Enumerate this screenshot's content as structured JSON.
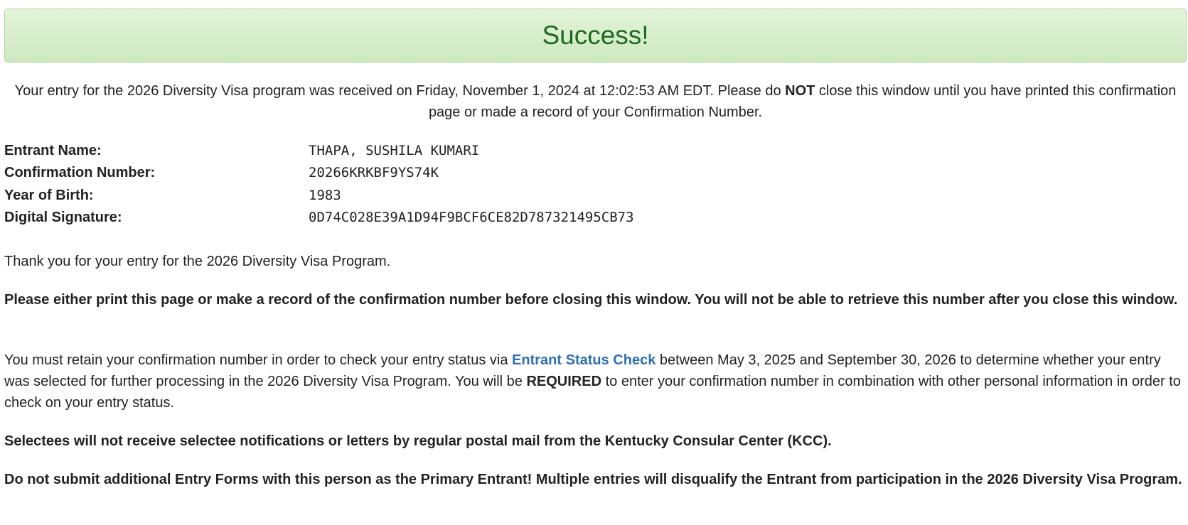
{
  "banner": {
    "title": "Success!"
  },
  "intro": {
    "part1": "Your entry for the 2026 Diversity Visa program was received on Friday, November 1, 2024 at 12:02:53 AM EDT. Please do ",
    "emphasis": "NOT",
    "part2": " close this window until you have printed this confirmation page or made a record of your Confirmation Number."
  },
  "entrant": {
    "name_label": "Entrant Name:",
    "name_value": "THAPA, SUSHILA KUMARI",
    "confirmation_label": "Confirmation Number:",
    "confirmation_value": "20266KRKBF9YS74K",
    "birth_label": "Year of Birth:",
    "birth_value": "1983",
    "signature_label": "Digital Signature:",
    "signature_value": "0D74C028E39A1D94F9BCF6CE82D787321495CB73"
  },
  "messages": {
    "thank_you": "Thank you for your entry for the 2026 Diversity Visa Program.",
    "print_warning": "Please either print this page or make a record of the confirmation number before closing this window. You will not be able to retrieve this number after you close this window.",
    "retain_part1": "You must retain your confirmation number in order to check your entry status via ",
    "retain_link": "Entrant Status Check",
    "retain_part2": " between May 3, 2025 and September 30, 2026 to determine whether your entry was selected for further processing in the 2026 Diversity Visa Program. You will be ",
    "retain_required": "REQUIRED",
    "retain_part3": " to enter your confirmation number in combination with other personal information in order to check on your entry status.",
    "selectees_notice": "Selectees will not receive selectee notifications or letters by regular postal mail from the Kentucky Consular Center (KCC).",
    "duplicate_warning": "Do not submit additional Entry Forms with this person as the Primary Entrant! Multiple entries will disqualify the Entrant from participation in the 2026 Diversity Visa Program."
  },
  "colors": {
    "banner_background": "#dff0d8",
    "banner_text": "#1e6a1e",
    "link": "#2f6fb3",
    "body_text": "#222222"
  }
}
